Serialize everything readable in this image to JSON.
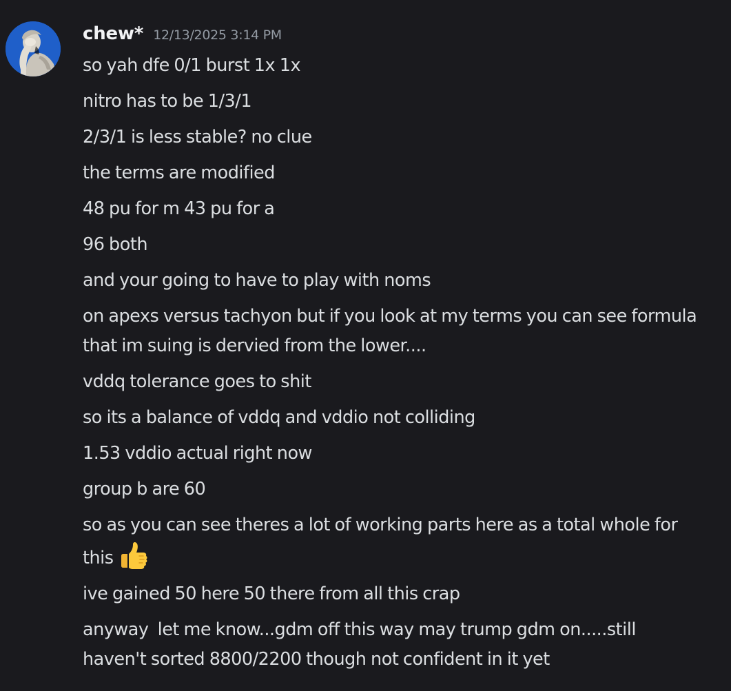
{
  "message": {
    "author": "chew*",
    "timestamp": "12/13/2025 3:14 PM",
    "avatar_icon": "statue-facepalm-avatar",
    "lines": [
      "so yah dfe 0/1 burst 1x 1x",
      "nitro has to be 1/3/1",
      "2/3/1 is less stable? no clue",
      "the terms are modified",
      "48 pu for m 43 pu for a",
      "96 both",
      "and your going to have to play with noms",
      "on apexs versus tachyon but if you look at my terms you can see formula that im suing is dervied from the lower....",
      "vddq tolerance goes to shit",
      "so its a balance of vddq and vddio not colliding",
      "1.53 vddio actual right now",
      "group b are 60",
      "so as you can see theres a lot of working parts here as a total whole for this",
      "ive gained 50 here 50 there from all this crap",
      "anyway  let me know...gdm off this way may trump gdm on.....still haven't sorted 8800/2200 though not confident in it yet"
    ],
    "emoji": "thumbs-up-emoji"
  },
  "colors": {
    "background": "#1a1a1e",
    "text": "#dbdee1",
    "username": "#f2f3f5",
    "timestamp": "#949ba4",
    "avatar_bg": "#1f5fc9"
  }
}
